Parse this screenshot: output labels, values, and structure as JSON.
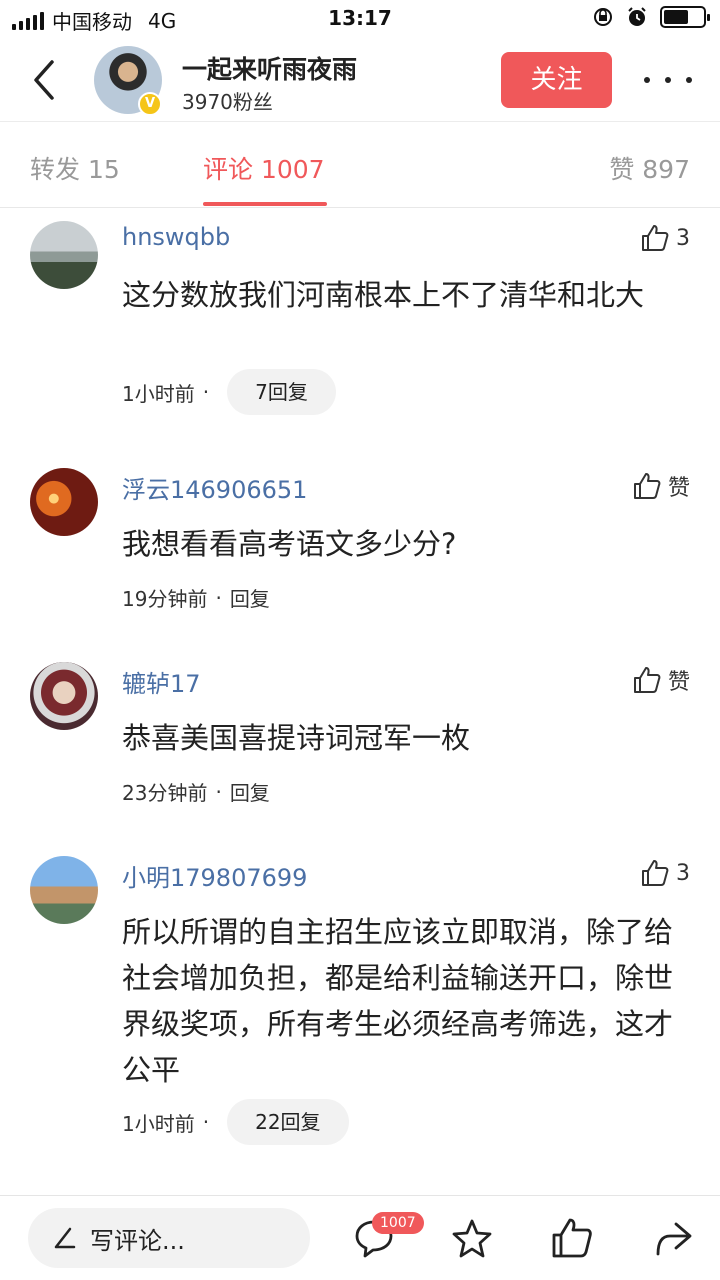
{
  "status_bar": {
    "carrier": "中国移动",
    "network": "4G",
    "time": "13:17"
  },
  "header": {
    "author_name": "一起来听雨夜雨",
    "fans": "3970粉丝",
    "verified_mark": "V",
    "follow_label": "关注"
  },
  "tabs": {
    "repost": "转发 15",
    "comment": "评论 1007",
    "like": "赞 897",
    "active": "comment"
  },
  "comments": [
    {
      "user": "hnswqbb",
      "likes": "3",
      "text": "这分数放我们河南根本上不了清华和北大",
      "time": "1小时前",
      "separator": "·",
      "reply": "7回复"
    },
    {
      "user": "浮云146906651",
      "likes": "赞",
      "text": "我想看看高考语文多少分?",
      "time": "19分钟前",
      "separator": "·",
      "reply": "回复"
    },
    {
      "user": "辘轳17",
      "likes": "赞",
      "text": "恭喜美国喜提诗词冠军一枚",
      "time": "23分钟前",
      "separator": "·",
      "reply": "回复"
    },
    {
      "user": "小明179807699",
      "likes": "3",
      "text": "所以所谓的自主招生应该立即取消，除了给社会增加负担，都是给利益输送开口，除世界级奖项，所有考生必须经高考筛选，这才公平",
      "time": "1小时前",
      "separator": "·",
      "reply": "22回复"
    }
  ],
  "bottom_bar": {
    "input_placeholder": "写评论...",
    "comment_count_badge": "1007"
  },
  "colors": {
    "accent": "#f0585a",
    "username": "#4a6fa5"
  },
  "icons": [
    "back-arrow-icon",
    "more-dots-icon",
    "thumbs-up-icon",
    "pen-icon",
    "comment-bubble-icon",
    "star-icon",
    "share-arrow-icon"
  ]
}
